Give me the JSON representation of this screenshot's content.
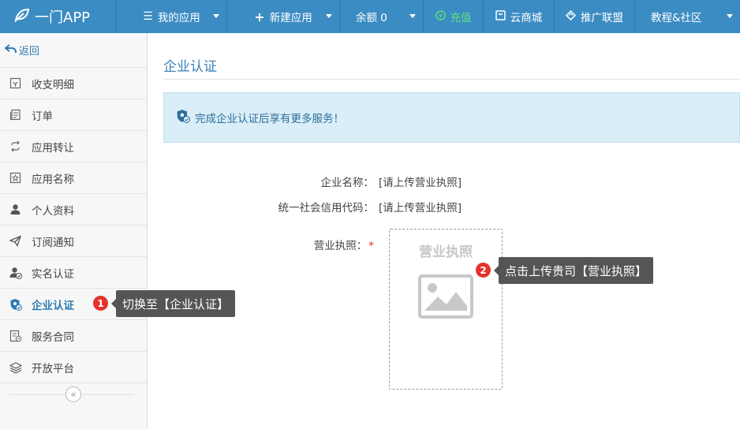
{
  "header": {
    "logo_text": "一门APP",
    "nav": [
      {
        "label": "我的应用",
        "icon": "menu-icon"
      },
      {
        "label": "新建应用",
        "icon": "plus-icon"
      },
      {
        "label": "余额 0"
      },
      {
        "label": "充值",
        "icon": "recharge-icon"
      },
      {
        "label": "云商城",
        "icon": "store-icon"
      },
      {
        "label": "推广联盟",
        "icon": "diamond-icon"
      },
      {
        "label": "教程&社区"
      }
    ]
  },
  "sidebar": {
    "back_label": "返回",
    "items": [
      {
        "label": "收支明细",
        "icon": "ledger-icon"
      },
      {
        "label": "订单",
        "icon": "order-icon"
      },
      {
        "label": "应用转让",
        "icon": "transfer-icon"
      },
      {
        "label": "应用名称",
        "icon": "star-icon"
      },
      {
        "label": "个人资料",
        "icon": "user-icon"
      },
      {
        "label": "订阅通知",
        "icon": "send-icon"
      },
      {
        "label": "实名认证",
        "icon": "user-verified-icon"
      },
      {
        "label": "企业认证",
        "icon": "shield-icon",
        "active": true
      },
      {
        "label": "服务合同",
        "icon": "contract-icon"
      },
      {
        "label": "开放平台",
        "icon": "layers-icon"
      }
    ],
    "collapse_glyph": "«"
  },
  "main": {
    "title": "企业认证",
    "alert_text": "完成企业认证后享有更多服务！",
    "fields": {
      "company_name_label": "企业名称：",
      "company_name_value": "[请上传营业执照]",
      "credit_code_label": "统一社会信用代码：",
      "credit_code_value": "[请上传营业执照]",
      "license_label": "营业执照：",
      "required_mark": "*"
    },
    "upload_text": "营业执照"
  },
  "tooltips": [
    {
      "badge": "1",
      "text": "切换至【企业认证】"
    },
    {
      "badge": "2",
      "text": "点击上传贵司【营业执照】"
    }
  ],
  "colors": {
    "topbar": "#3b8cc3",
    "accent": "#2f7bb3",
    "recharge": "#5fe07c",
    "badge": "#e5322d",
    "tooltip": "#555555"
  }
}
